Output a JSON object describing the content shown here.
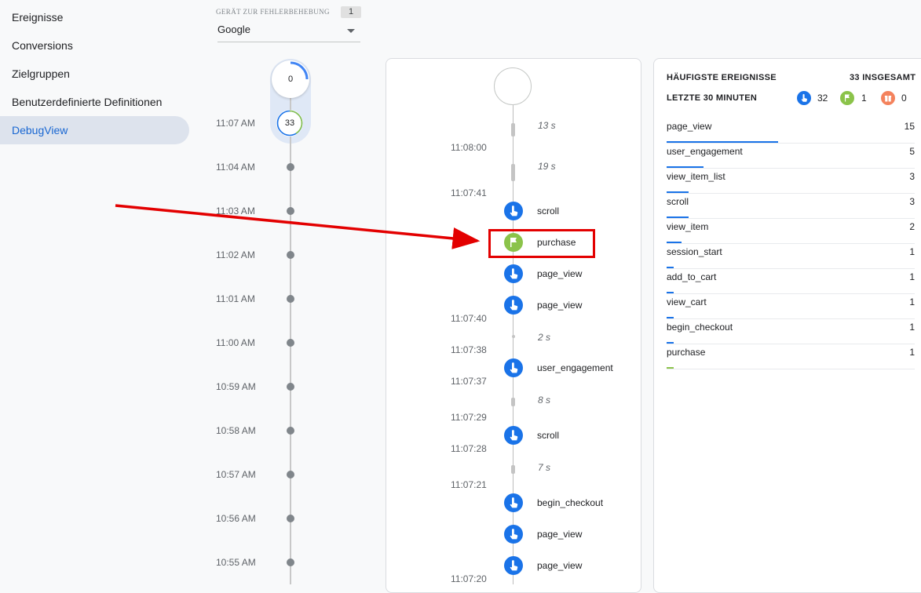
{
  "nav": {
    "items": [
      {
        "label": "Ereignisse"
      },
      {
        "label": "Conversions"
      },
      {
        "label": "Zielgruppen"
      },
      {
        "label": "Benutzerdefinierte Definitionen"
      },
      {
        "label": "DebugView"
      }
    ]
  },
  "device": {
    "label": "GERÄT ZUR FEHLERBEHEBUNG",
    "count": "1",
    "selected": "Google"
  },
  "minutes": {
    "top_count": "0",
    "current_count": "33",
    "current_time": "11:07 AM",
    "times": [
      "11:04 AM",
      "11:03 AM",
      "11:02 AM",
      "11:01 AM",
      "11:00 AM",
      "10:59 AM",
      "10:58 AM",
      "10:57 AM",
      "10:56 AM",
      "10:55 AM"
    ]
  },
  "seconds": {
    "gaps": [
      "13 s",
      "19 s",
      "2 s",
      "8 s",
      "7 s"
    ],
    "times": [
      "11:08:00",
      "11:07:41",
      "11:07:40",
      "11:07:38",
      "11:07:37",
      "11:07:29",
      "11:07:28",
      "11:07:21",
      "11:07:20"
    ],
    "events": [
      {
        "name": "scroll",
        "icon": "touch-icon",
        "color": "#1a73e8"
      },
      {
        "name": "purchase",
        "icon": "flag-icon",
        "color": "#8bc34a"
      },
      {
        "name": "page_view",
        "icon": "touch-icon",
        "color": "#1a73e8"
      },
      {
        "name": "page_view",
        "icon": "touch-icon",
        "color": "#1a73e8"
      },
      {
        "name": "user_engagement",
        "icon": "touch-icon",
        "color": "#1a73e8"
      },
      {
        "name": "scroll",
        "icon": "touch-icon",
        "color": "#1a73e8"
      },
      {
        "name": "begin_checkout",
        "icon": "touch-icon",
        "color": "#1a73e8"
      },
      {
        "name": "page_view",
        "icon": "touch-icon",
        "color": "#1a73e8"
      },
      {
        "name": "page_view",
        "icon": "touch-icon",
        "color": "#1a73e8"
      }
    ]
  },
  "stats": {
    "title": "HÄUFIGSTE EREIGNISSE",
    "total": "33 INSGESAMT",
    "subtitle": "LETZTE 30 MINUTEN",
    "legend": [
      {
        "icon": "touch-icon",
        "color": "#1a73e8",
        "value": "32"
      },
      {
        "icon": "flag-icon",
        "color": "#8bc34a",
        "value": "1"
      },
      {
        "icon": "gift-icon",
        "color": "#f4825c",
        "value": "0"
      }
    ],
    "rows": [
      {
        "name": "page_view",
        "count": "15",
        "fraction": 0.45
      },
      {
        "name": "user_engagement",
        "count": "5",
        "fraction": 0.15
      },
      {
        "name": "view_item_list",
        "count": "3",
        "fraction": 0.09
      },
      {
        "name": "scroll",
        "count": "3",
        "fraction": 0.09
      },
      {
        "name": "view_item",
        "count": "2",
        "fraction": 0.06
      },
      {
        "name": "session_start",
        "count": "1",
        "fraction": 0.03
      },
      {
        "name": "add_to_cart",
        "count": "1",
        "fraction": 0.03
      },
      {
        "name": "view_cart",
        "count": "1",
        "fraction": 0.03
      },
      {
        "name": "begin_checkout",
        "count": "1",
        "fraction": 0.03
      },
      {
        "name": "purchase",
        "count": "1",
        "fraction": 0.03
      }
    ]
  },
  "colors": {
    "accent": "#1a73e8",
    "conversion": "#8bc34a",
    "highlight": "#e30000"
  }
}
